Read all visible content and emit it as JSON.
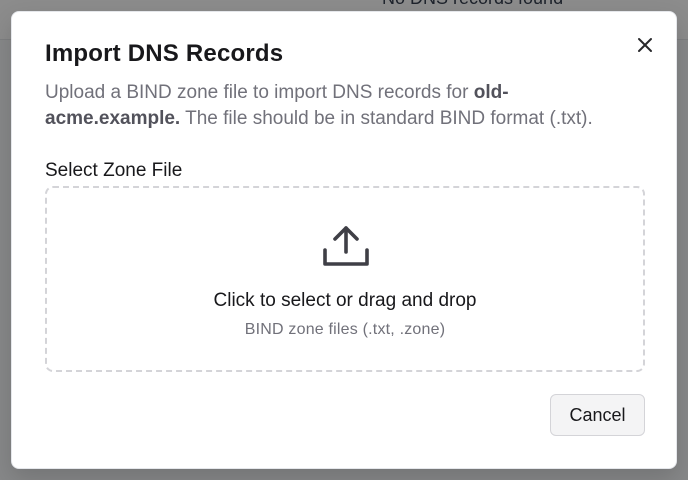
{
  "background": {
    "peek_text": "No DNS records found"
  },
  "dialog": {
    "title": "Import DNS Records",
    "description_prefix": "Upload a BIND zone file to import DNS records for ",
    "domain": "old-acme.example.",
    "description_suffix": " The file should be in standard BIND format (.txt).",
    "field_label": "Select Zone File",
    "dropzone": {
      "primary_text": "Click to select or drag and drop",
      "secondary_text": "BIND zone files (.txt, .zone)",
      "icon": "upload-icon"
    },
    "cancel_label": "Cancel",
    "close_icon": "close-icon"
  }
}
